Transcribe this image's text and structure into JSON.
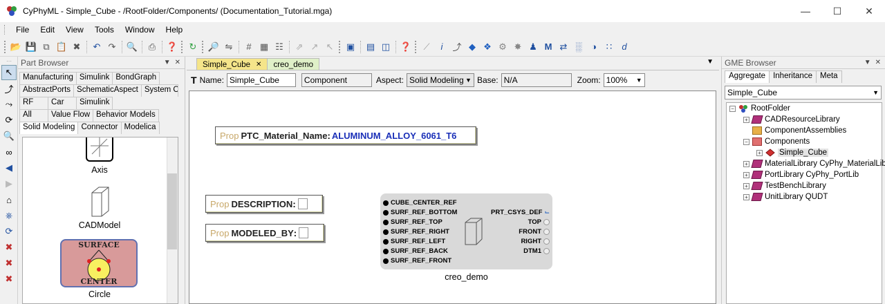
{
  "window": {
    "title": "CyPhyML - Simple_Cube - /RootFolder/Components/ (Documentation_Tutorial.mga)",
    "controls": [
      "minimize-icon",
      "maximize-icon",
      "close-icon"
    ]
  },
  "menu": [
    "File",
    "Edit",
    "View",
    "Tools",
    "Window",
    "Help"
  ],
  "toolbar_icons": [
    "open-icon",
    "save-icon",
    "copy-icon",
    "paste-icon",
    "delete-icon",
    "undo-icon",
    "redo-icon",
    "find-icon",
    "print-icon",
    "help-icon",
    "refresh-icon",
    "zoom-icon",
    "connect-icon",
    "grid-icon",
    "align-icon",
    "select-icon",
    "run-icon",
    "check-icon",
    "interpreter-icon"
  ],
  "part_browser": {
    "title": "Part Browser",
    "tab_rows": [
      [
        "Manufacturing",
        "Simulink",
        "BondGraph"
      ],
      [
        "AbstractPorts",
        "SchematicAspect",
        "System C"
      ],
      [
        "RF",
        "Car",
        "Simulink"
      ],
      [
        "All",
        "Value Flow",
        "Behavior Models"
      ],
      [
        "Solid Modeling",
        "Connector",
        "Modelica"
      ]
    ],
    "active_tab": "Solid Modeling",
    "parts": [
      "Axis",
      "CADModel",
      "Circle"
    ],
    "circle_icon_text_top": "SURFACE",
    "circle_icon_text_bottom": "CENTER"
  },
  "editor": {
    "tabs": [
      {
        "label": "Simple_Cube",
        "active": true
      },
      {
        "label": "creo_demo",
        "active": false
      }
    ],
    "name_label": "Name:",
    "name_value": "Simple_Cube",
    "kind_value": "Component",
    "aspect_label": "Aspect:",
    "aspect_value": "Solid Modeling",
    "base_label": "Base:",
    "base_value": "N/A",
    "zoom_label": "Zoom:",
    "zoom_value": "100%",
    "props": [
      {
        "kind": "Prop",
        "name": "PTC_Material_Name",
        "value": "ALUMINUM_ALLOY_6061_T6"
      },
      {
        "kind": "Prop",
        "name": "DESCRIPTION",
        "value": ""
      },
      {
        "kind": "Prop",
        "name": "MODELED_BY",
        "value": ""
      }
    ],
    "component": {
      "name": "creo_demo",
      "left_ports": [
        "CUBE_CENTER_REF",
        "SURF_REF_BOTTOM",
        "SURF_REF_TOP",
        "SURF_REF_RIGHT",
        "SURF_REF_LEFT",
        "SURF_REF_BACK",
        "SURF_REF_FRONT"
      ],
      "right_ports": [
        "PRT_CSYS_DEF",
        "TOP",
        "FRONT",
        "RIGHT",
        "DTM1"
      ]
    }
  },
  "gme_browser": {
    "title": "GME Browser",
    "tabs": [
      "Aggregate",
      "Inheritance",
      "Meta"
    ],
    "active_tab": "Aggregate",
    "selector": "Simple_Cube",
    "tree": [
      {
        "label": "RootFolder",
        "level": 0,
        "expander": "-",
        "icon": "root"
      },
      {
        "label": "CADResourceLibrary",
        "level": 1,
        "expander": "+",
        "icon": "lib"
      },
      {
        "label": "ComponentAssemblies",
        "level": 1,
        "expander": "",
        "icon": "fold"
      },
      {
        "label": "Components",
        "level": 1,
        "expander": "-",
        "icon": "fold red"
      },
      {
        "label": "Simple_Cube",
        "level": 2,
        "expander": "+",
        "icon": "comp"
      },
      {
        "label": "MaterialLibrary CyPhy_MaterialLib",
        "level": 1,
        "expander": "+",
        "icon": "lib"
      },
      {
        "label": "PortLibrary CyPhy_PortLib",
        "level": 1,
        "expander": "+",
        "icon": "lib"
      },
      {
        "label": "TestBenchLibrary",
        "level": 1,
        "expander": "+",
        "icon": "lib"
      },
      {
        "label": "UnitLibrary QUDT",
        "level": 1,
        "expander": "+",
        "icon": "lib"
      }
    ]
  }
}
